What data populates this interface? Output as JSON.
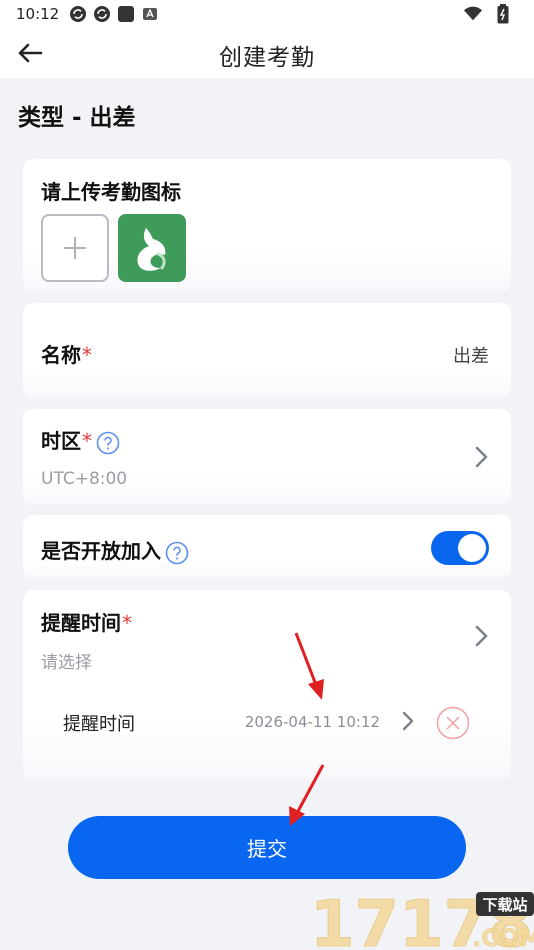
{
  "status_bar": {
    "time": "10:12"
  },
  "header": {
    "title": "创建考勤"
  },
  "section": {
    "title": "类型 - 出差"
  },
  "upload": {
    "label": "请上传考勤图标"
  },
  "name_field": {
    "label": "名称",
    "required_mark": "*",
    "value": "出差"
  },
  "timezone": {
    "label": "时区",
    "required_mark": "*",
    "value": "UTC+8:00"
  },
  "open_join": {
    "label": "是否开放加入",
    "enabled": true
  },
  "reminder": {
    "label": "提醒时间",
    "required_mark": "*",
    "placeholder": "请选择",
    "items": [
      {
        "label": "提醒时间",
        "value": "2026-04-11 10:12"
      }
    ]
  },
  "submit": {
    "label": "提交"
  },
  "watermark": {
    "number": "17178",
    "badge": "下载站",
    "domain": ".COM"
  },
  "colors": {
    "accent": "#0866f0",
    "required": "#e53935",
    "annotation_arrow": "#e02020",
    "delete": "#f0a0a4"
  }
}
